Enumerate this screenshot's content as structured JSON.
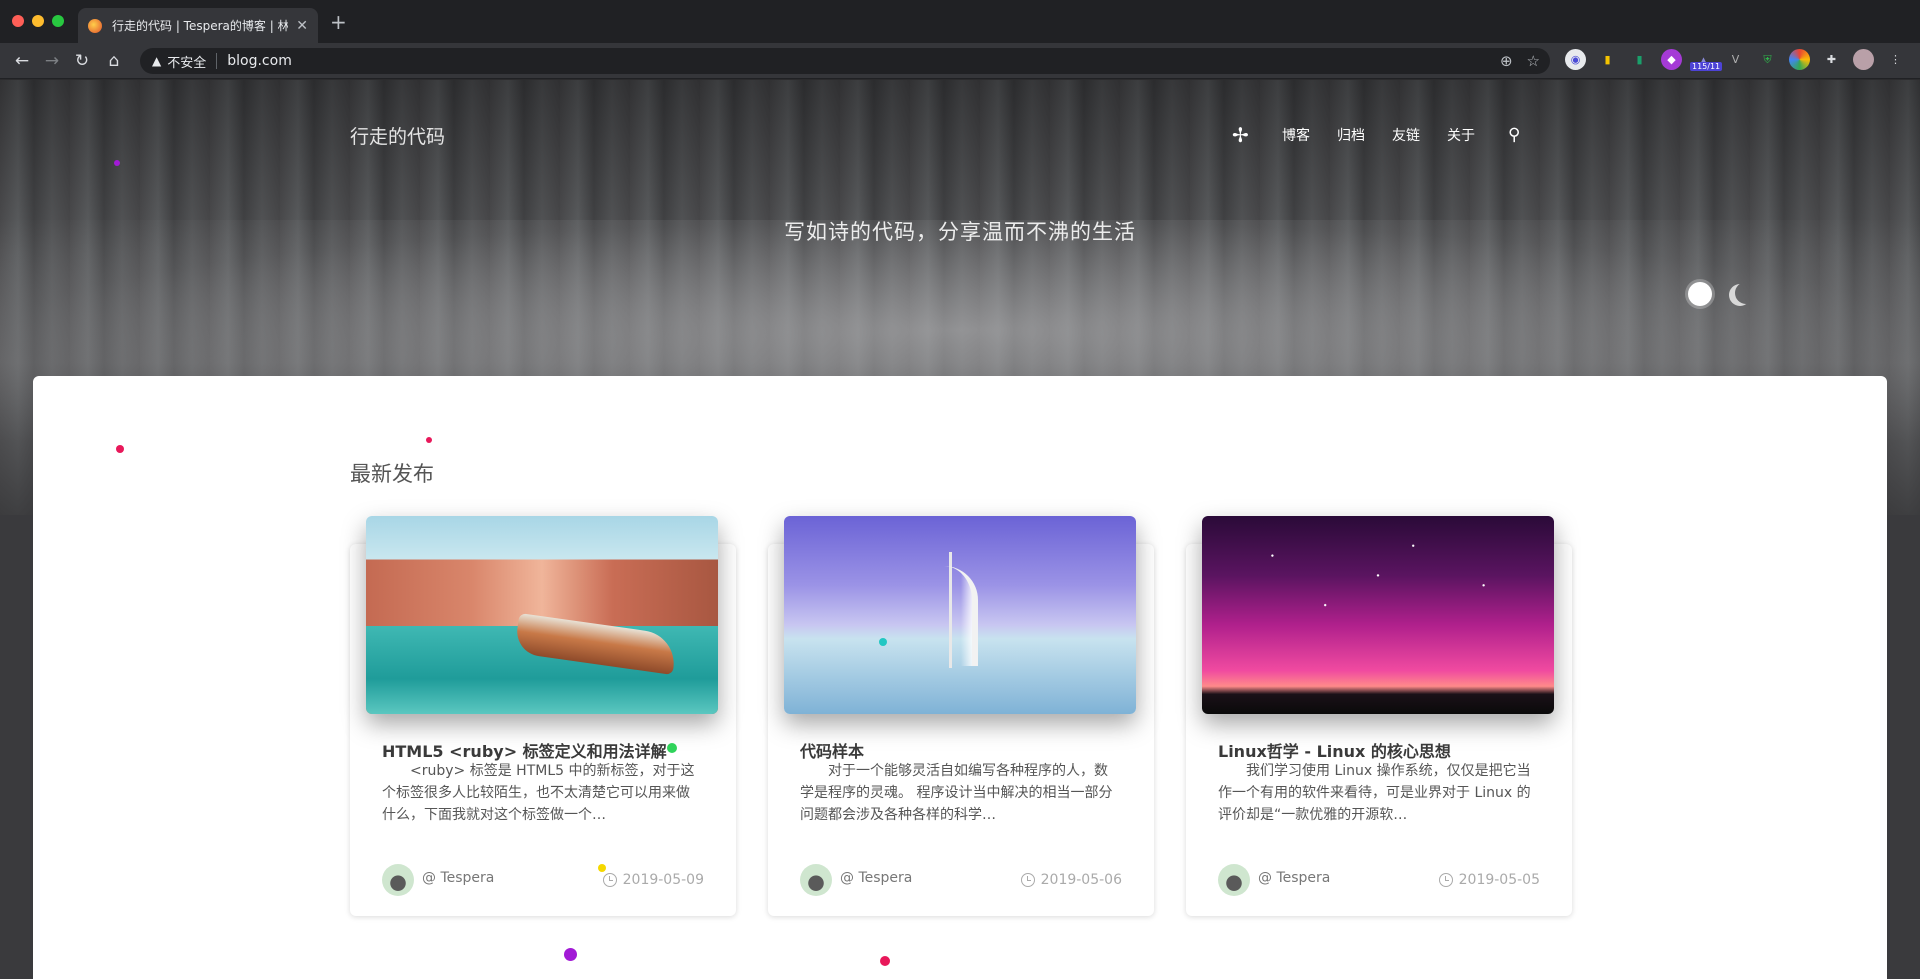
{
  "browser": {
    "tab_title": "行走的代码 | Tespera的博客 | 林",
    "tab_close": "✕",
    "new_tab": "+",
    "security_label": "不安全",
    "url": "blog.com",
    "extension_badge": "115/11"
  },
  "site": {
    "title": "行走的代码",
    "nav": [
      "博客",
      "归档",
      "友链",
      "关于"
    ],
    "slogan": "写如诗的代码，分享温而不沸的生活"
  },
  "section_title": "最新发布",
  "posts": [
    {
      "title": "HTML5 <ruby> 标签定义和用法详解",
      "excerpt": "<ruby> 标签是 HTML5 中的新标签，对于这个标签很多人比较陌生，也不太清楚它可以用来做什么，下面我就对这个标签做一个…",
      "author": "@ Tespera",
      "date": "2019-05-09",
      "image": "venice-canal"
    },
    {
      "title": "代码样本",
      "excerpt": "对于一个能够灵活自如编写各种程序的人，数学是程序的灵魂。 程序设计当中解决的相当一部分问题都会涉及各种各样的科学…",
      "author": "@ Tespera",
      "date": "2019-05-06",
      "image": "burj-al-arab"
    },
    {
      "title": "Linux哲学 - Linux 的核心思想",
      "excerpt": "我们学习使用 Linux 操作系统，仅仅是把它当作一个有用的软件来看待，可是业界对于 Linux 的评价却是“一款优雅的开源软…",
      "author": "@ Tespera",
      "date": "2019-05-05",
      "image": "starry-night-sky"
    }
  ],
  "colors": {
    "accent_dot_red": "#e8185a",
    "accent_dot_purple": "#a21ad6",
    "accent_dot_green": "#2fd35a",
    "accent_dot_yellow": "#f5d800",
    "accent_dot_cyan": "#22c7c3"
  }
}
